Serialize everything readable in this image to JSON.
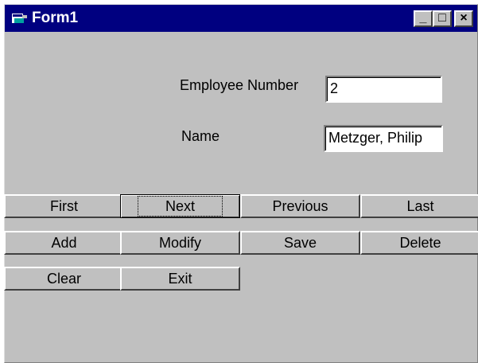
{
  "window": {
    "title": "Form1",
    "controls": {
      "minimize": "_",
      "maximize": "□",
      "close": "×"
    }
  },
  "form": {
    "employee_number_label": "Employee Number",
    "employee_number_value": "2",
    "name_label": "Name",
    "name_value": "Metzger, Philip"
  },
  "buttons": {
    "row1": [
      "First",
      "Next",
      "Previous",
      "Last"
    ],
    "row2": [
      "Add",
      "Modify",
      "Save",
      "Delete"
    ],
    "row3": [
      "Clear",
      "Exit"
    ]
  },
  "colors": {
    "titlebar": "#000080",
    "face": "#c0c0c0"
  }
}
